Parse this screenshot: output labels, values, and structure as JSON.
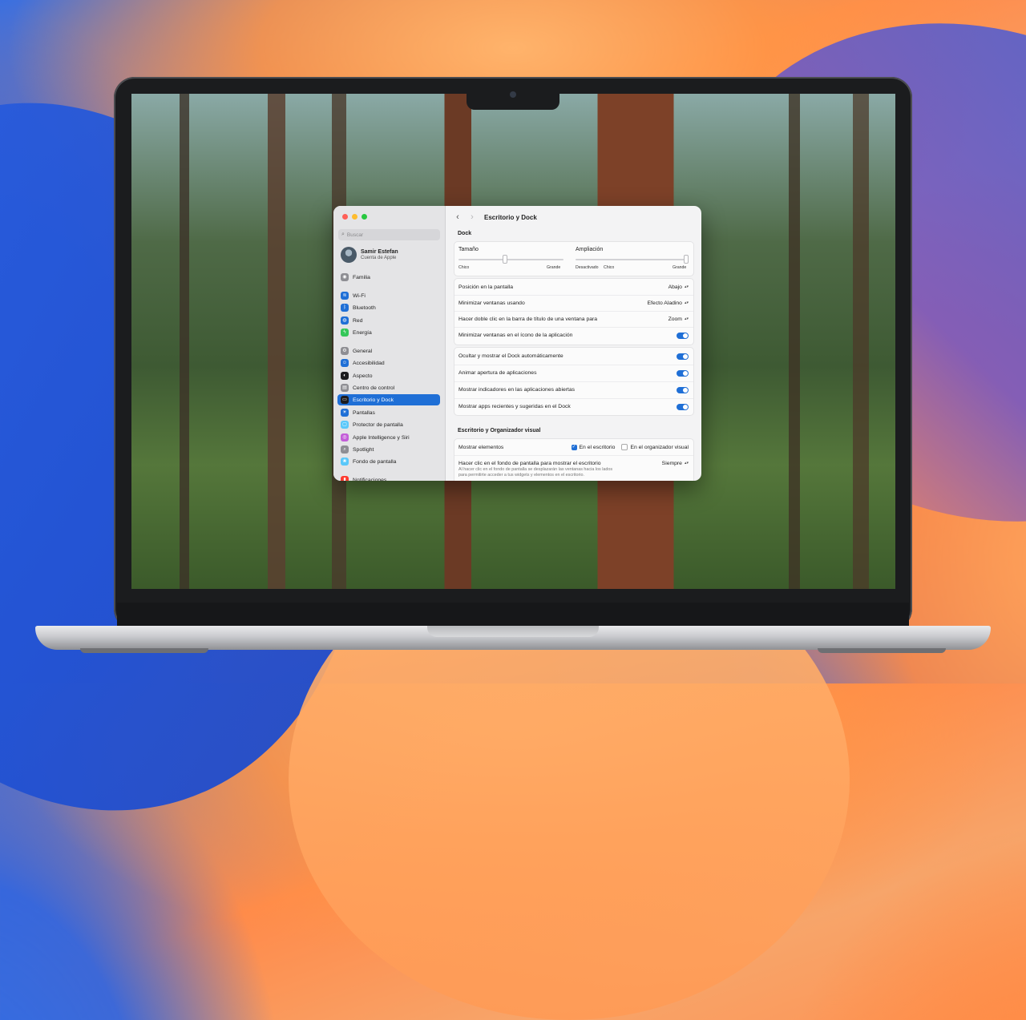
{
  "window": {
    "title": "Escritorio y Dock",
    "traffic_lights": {
      "close": "#ff5f57",
      "minimize": "#febc2e",
      "zoom": "#28c840"
    }
  },
  "sidebar": {
    "search_placeholder": "Buscar",
    "account": {
      "name": "Samir Estefan",
      "subtitle": "Cuenta de Apple"
    },
    "items": [
      {
        "label": "Familia",
        "icon": "family-icon",
        "color": "#8e8e93"
      },
      {
        "label": "Wi-Fi",
        "icon": "wifi-icon",
        "color": "#1f6fd6"
      },
      {
        "label": "Bluetooth",
        "icon": "bluetooth-icon",
        "color": "#1f6fd6"
      },
      {
        "label": "Red",
        "icon": "network-icon",
        "color": "#1f6fd6"
      },
      {
        "label": "Energía",
        "icon": "battery-icon",
        "color": "#34c759"
      },
      {
        "label": "General",
        "icon": "gear-icon",
        "color": "#8e8e93"
      },
      {
        "label": "Accesibilidad",
        "icon": "accessibility-icon",
        "color": "#1f6fd6"
      },
      {
        "label": "Aspecto",
        "icon": "appearance-icon",
        "color": "#1c1c1e"
      },
      {
        "label": "Centro de control",
        "icon": "control-center-icon",
        "color": "#8e8e93"
      },
      {
        "label": "Escritorio y Dock",
        "icon": "desktop-dock-icon",
        "color": "#1c1c1e",
        "active": true
      },
      {
        "label": "Pantallas",
        "icon": "displays-icon",
        "color": "#1f6fd6"
      },
      {
        "label": "Protector de pantalla",
        "icon": "screensaver-icon",
        "color": "#5ac8fa"
      },
      {
        "label": "Apple Intelligence y Siri",
        "icon": "siri-icon",
        "color": "#c35dd8"
      },
      {
        "label": "Spotlight",
        "icon": "spotlight-icon",
        "color": "#8e8e93"
      },
      {
        "label": "Fondo de pantalla",
        "icon": "wallpaper-icon",
        "color": "#5ac8fa"
      },
      {
        "label": "Notificaciones",
        "icon": "notifications-icon",
        "color": "#ff3b30"
      }
    ]
  },
  "main": {
    "dock_section": "Dock",
    "size": {
      "title": "Tamaño",
      "min": "Chico",
      "max": "Grande",
      "value": 0.44
    },
    "magnification": {
      "title": "Ampliación",
      "off": "Desactivado",
      "min": "Chico",
      "max": "Grande",
      "value": 1.0
    },
    "rows": [
      {
        "label": "Posición en la pantalla",
        "value": "Abajo"
      },
      {
        "label": "Minimizar ventanas usando",
        "value": "Efecto Aladino"
      },
      {
        "label": "Hacer doble clic en la barra de título de una ventana para",
        "value": "Zoom"
      },
      {
        "label": "Minimizar ventanas en el ícono de la aplicación",
        "toggle": true
      }
    ],
    "toggles": [
      {
        "label": "Ocultar y mostrar el Dock automáticamente",
        "on": true
      },
      {
        "label": "Animar apertura de aplicaciones",
        "on": true
      },
      {
        "label": "Mostrar indicadores en las aplicaciones abiertas",
        "on": true
      },
      {
        "label": "Mostrar apps recientes y sugeridas en el Dock",
        "on": true
      }
    ],
    "desktop_section": "Escritorio y Organizador visual",
    "show_items": {
      "label": "Mostrar elementos",
      "opt1": "En el escritorio",
      "opt1_checked": true,
      "opt2": "En el organizador visual",
      "opt2_checked": false
    },
    "click_wallpaper": {
      "label": "Hacer clic en el fondo de pantalla para mostrar el escritorio",
      "value": "Siempre",
      "note_line1": "Al hacer clic en el fondo de pantalla se desplazarán las ventanas hacia los lados",
      "note_line2": "para permitirte acceder a tus widgets y elementos en el escritorio."
    }
  }
}
